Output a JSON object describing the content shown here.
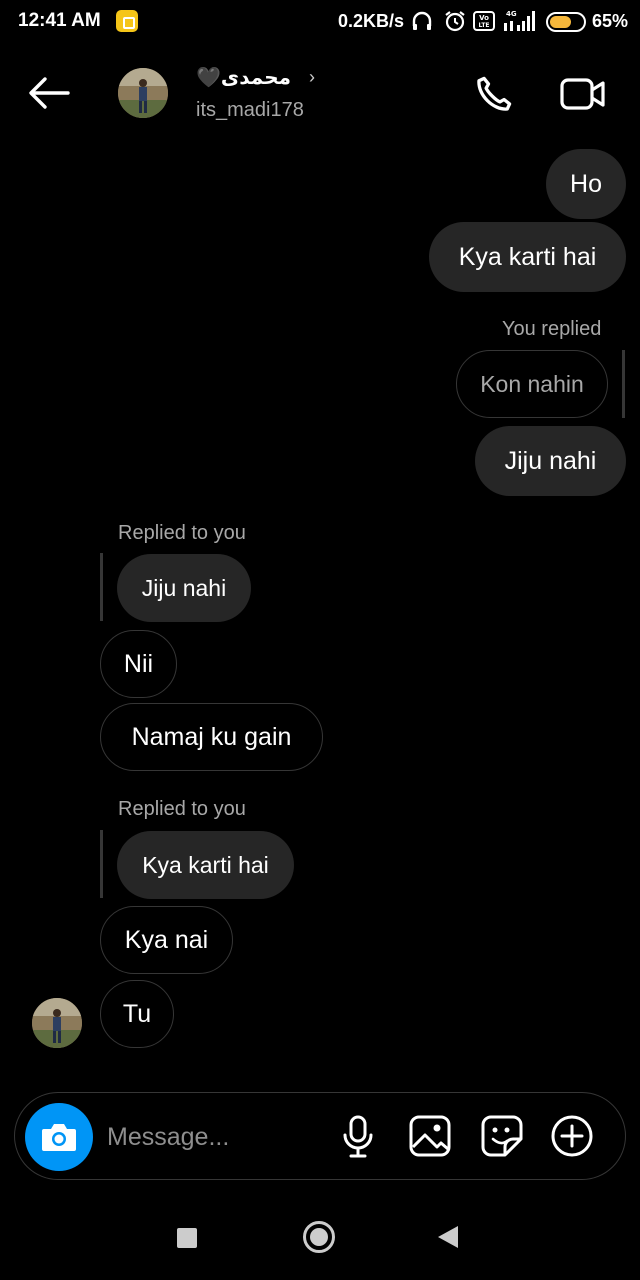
{
  "status_bar": {
    "time": "12:41 AM",
    "net_speed": "0.2KB/s",
    "battery_pct": "65%",
    "battery_level": 0.65,
    "icons": [
      "notification-icon",
      "headphones-icon",
      "alarm-icon",
      "volte-icon",
      "signal-icon",
      "battery-icon"
    ]
  },
  "header": {
    "name": "محمدی🖤",
    "username": "its_madi178",
    "icons": [
      "back-arrow-icon",
      "chevron-right-icon",
      "phone-call-icon",
      "video-call-icon"
    ]
  },
  "messages": [
    {
      "type": "sent",
      "text": "Ho"
    },
    {
      "type": "sent",
      "text": "Kya karti hai"
    },
    {
      "type": "sent_reply",
      "label": "You replied",
      "quoted": "Kon nahin",
      "text": "Jiju nahi"
    },
    {
      "type": "received_reply",
      "label": "Replied to you",
      "quoted": "Jiju nahi"
    },
    {
      "type": "received",
      "text": "Nii"
    },
    {
      "type": "received",
      "text": "Namaj ku gain"
    },
    {
      "type": "received_reply",
      "label": "Replied to you",
      "quoted": "Kya karti hai"
    },
    {
      "type": "received",
      "text": "Kya nai"
    },
    {
      "type": "received",
      "text": "Tu"
    }
  ],
  "composer": {
    "placeholder": "Message...",
    "icons": [
      "camera-icon",
      "microphone-icon",
      "gallery-icon",
      "sticker-icon",
      "plus-icon"
    ]
  },
  "nav_bar": {
    "icons": [
      "recents-icon",
      "home-icon",
      "back-icon"
    ]
  },
  "colors": {
    "background": "#000000",
    "sent_bubble": "#262626",
    "outline": "#363636",
    "camera_button": "#0095f6",
    "secondary_text": "#a8a8a8",
    "battery": "#f5b73b"
  }
}
